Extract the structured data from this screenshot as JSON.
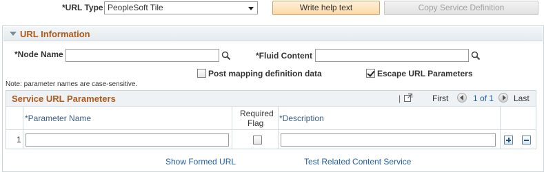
{
  "url_type": {
    "label": "*URL Type",
    "selected": "PeopleSoft Tile"
  },
  "buttons": {
    "write_help": "Write help text",
    "copy_service": "Copy Service Definition"
  },
  "section": {
    "title": "URL Information"
  },
  "fields": {
    "node_name_label": "*Node Name",
    "node_name_value": "",
    "fluid_content_label": "*Fluid Content",
    "fluid_content_value": ""
  },
  "checkboxes": {
    "post_mapping": {
      "label": "Post mapping definition data",
      "checked": false
    },
    "escape_url": {
      "label": "Escape URL Parameters",
      "checked": true
    }
  },
  "note": "Note: parameter names are case-sensitive.",
  "grid": {
    "title": "Service URL Parameters",
    "nav": {
      "first": "First",
      "range": "1 of 1",
      "last": "Last"
    },
    "columns": {
      "parameter_name": "*Parameter Name",
      "required_flag_1": "Required",
      "required_flag_2": "Flag",
      "description": "*Description"
    },
    "rows": [
      {
        "num": "1",
        "parameter_name": "",
        "required": false,
        "description": ""
      }
    ]
  },
  "links": {
    "show_formed_url": "Show Formed URL",
    "test_related": "Test Related Content Service"
  },
  "icons": [
    "search-icon",
    "chevron-down-icon",
    "collapse-triangle-icon",
    "grid-popout-icon",
    "previous-icon",
    "next-icon",
    "add-row-icon",
    "delete-row-icon"
  ],
  "colors": {
    "section_title": "#b05a1a",
    "link": "#1f5fa8",
    "primary_button": "#fbd9a8"
  }
}
